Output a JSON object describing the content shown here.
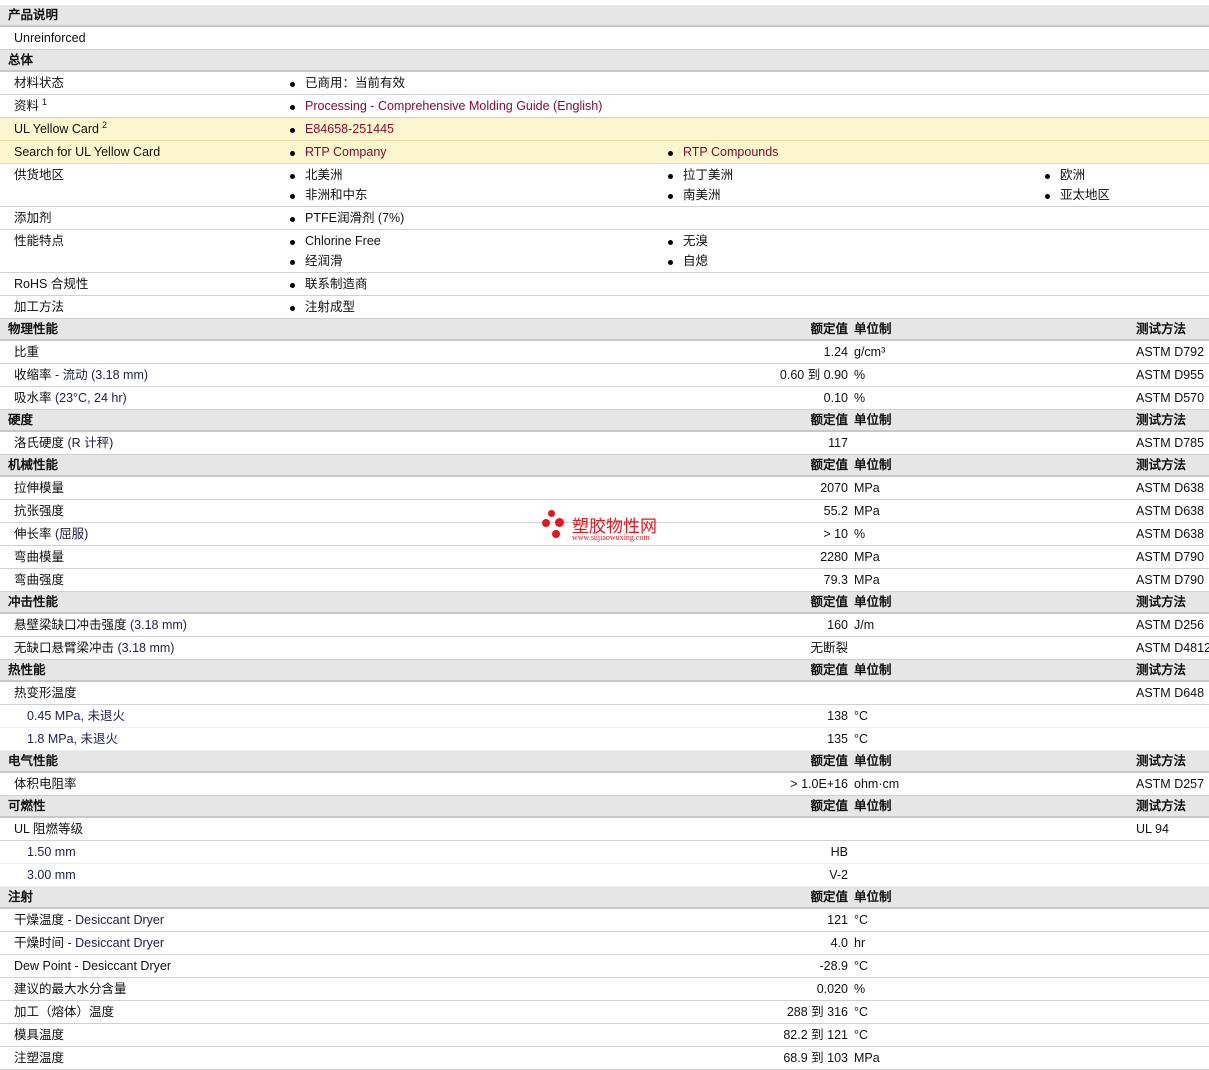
{
  "product": {
    "title": "产品说明",
    "desc": "Unreinforced"
  },
  "general": {
    "title": "总体",
    "rows": [
      {
        "label": "材料状态",
        "cols": [
          [
            "已商用：当前有效"
          ]
        ]
      },
      {
        "label": "资料",
        "sup": "1",
        "link": true,
        "cols": [
          [
            "Processing - Comprehensive Molding Guide (English)"
          ]
        ]
      },
      {
        "label": "UL Yellow Card",
        "sup": "2",
        "link": true,
        "yellow": true,
        "cols": [
          [
            "E84658-251445"
          ]
        ]
      },
      {
        "label": "Search for UL Yellow Card",
        "link": true,
        "yellow": true,
        "cols": [
          [
            "RTP Company"
          ],
          [
            "RTP Compounds"
          ]
        ]
      },
      {
        "label": "供货地区",
        "cols": [
          [
            "北美洲",
            "非洲和中东"
          ],
          [
            "拉丁美洲",
            "南美洲"
          ],
          [
            "欧洲",
            "亚太地区"
          ]
        ]
      },
      {
        "label": "添加剂",
        "cols": [
          [
            "PTFE润滑剂 (7%)"
          ]
        ]
      },
      {
        "label": "性能特点",
        "cols": [
          [
            "Chlorine Free",
            "经润滑"
          ],
          [
            "无溴",
            "自熄"
          ]
        ]
      },
      {
        "label": "RoHS 合规性",
        "cols": [
          [
            "联系制造商"
          ]
        ]
      },
      {
        "label": "加工方法",
        "cols": [
          [
            "注射成型"
          ]
        ]
      }
    ]
  },
  "headers": {
    "value": "额定值",
    "unit": "单位制",
    "test": "测试方法"
  },
  "sections": [
    {
      "title": "物理性能",
      "test": true,
      "rows": [
        {
          "label": "比重",
          "value": "1.24",
          "unit": "g/cm³",
          "test": "ASTM D792"
        },
        {
          "label": "收缩率",
          "cond": " - 流动  (3.18 mm)",
          "value": "0.60 到  0.90",
          "unit": "%",
          "test": "ASTM D955"
        },
        {
          "label": "吸水率",
          "cond": " (23°C, 24 hr)",
          "value": "0.10",
          "unit": "%",
          "test": "ASTM D570"
        }
      ]
    },
    {
      "title": "硬度",
      "test": true,
      "rows": [
        {
          "label": "洛氏硬度",
          "cond": " (R 计秤)",
          "value": "117",
          "unit": "",
          "test": "ASTM D785"
        }
      ]
    },
    {
      "title": "机械性能",
      "test": true,
      "rows": [
        {
          "label": "拉伸模量",
          "value": "2070",
          "unit": "MPa",
          "test": "ASTM D638"
        },
        {
          "label": "抗张强度",
          "value": "55.2",
          "unit": "MPa",
          "test": "ASTM D638"
        },
        {
          "label": "伸长率",
          "cond": " (屈服)",
          "value": "> 10",
          "unit": "%",
          "test": "ASTM D638"
        },
        {
          "label": "弯曲模量",
          "value": "2280",
          "unit": "MPa",
          "test": "ASTM D790"
        },
        {
          "label": "弯曲强度",
          "value": "79.3",
          "unit": "MPa",
          "test": "ASTM D790"
        }
      ]
    },
    {
      "title": "冲击性能",
      "test": true,
      "rows": [
        {
          "label": "悬壁梁缺口冲击强度",
          "cond": " (3.18 mm)",
          "value": "160",
          "unit": "J/m",
          "test": "ASTM D256"
        },
        {
          "label": "无缺口悬臂梁冲击",
          "cond": " (3.18 mm)",
          "value": "无断裂",
          "unit": "",
          "test": "ASTM D4812"
        }
      ]
    },
    {
      "title": "热性能",
      "test": true,
      "rows": [
        {
          "label": "热变形温度",
          "value": "",
          "unit": "",
          "test": "ASTM D648"
        },
        {
          "label": "0.45 MPa, 未退火",
          "sub": true,
          "value": "138",
          "unit": "°C",
          "test": ""
        },
        {
          "label": "1.8 MPa, 未退火",
          "sub": true,
          "value": "135",
          "unit": "°C",
          "test": ""
        }
      ]
    },
    {
      "title": "电气性能",
      "test": true,
      "rows": [
        {
          "label": "体积电阻率",
          "value": "> 1.0E+16",
          "unit": "ohm·cm",
          "test": "ASTM D257"
        }
      ]
    },
    {
      "title": "可燃性",
      "test": true,
      "rows": [
        {
          "label": "UL 阻燃等级",
          "value": "",
          "unit": "",
          "test": "UL 94"
        },
        {
          "label": "1.50 mm",
          "sub": true,
          "value": "HB",
          "unit": "",
          "test": ""
        },
        {
          "label": "3.00 mm",
          "sub": true,
          "value": "V-2",
          "unit": "",
          "test": ""
        }
      ]
    },
    {
      "title": "注射",
      "test": false,
      "rows": [
        {
          "label": "干燥温度",
          "cond": " - Desiccant Dryer",
          "value": "121",
          "unit": "°C",
          "test": ""
        },
        {
          "label": "干燥时间",
          "cond": " - Desiccant Dryer",
          "value": "4.0",
          "unit": "hr",
          "test": ""
        },
        {
          "label": "Dew Point - Desiccant Dryer",
          "value": "-28.9",
          "unit": "°C",
          "test": ""
        },
        {
          "label": "建议的最大水分含量",
          "value": "0.020",
          "unit": "%",
          "test": ""
        },
        {
          "label": "加工（熔体）温度",
          "value": "288 到  316",
          "unit": "°C",
          "test": ""
        },
        {
          "label": "模具温度",
          "value": "82.2 到  121",
          "unit": "°C",
          "test": ""
        },
        {
          "label": "注塑温度",
          "value": "68.9 到  103",
          "unit": "MPa",
          "test": ""
        }
      ]
    }
  ],
  "watermark": {
    "name": "塑胶物性网",
    "url": "www.sujiaowuxing.com"
  }
}
